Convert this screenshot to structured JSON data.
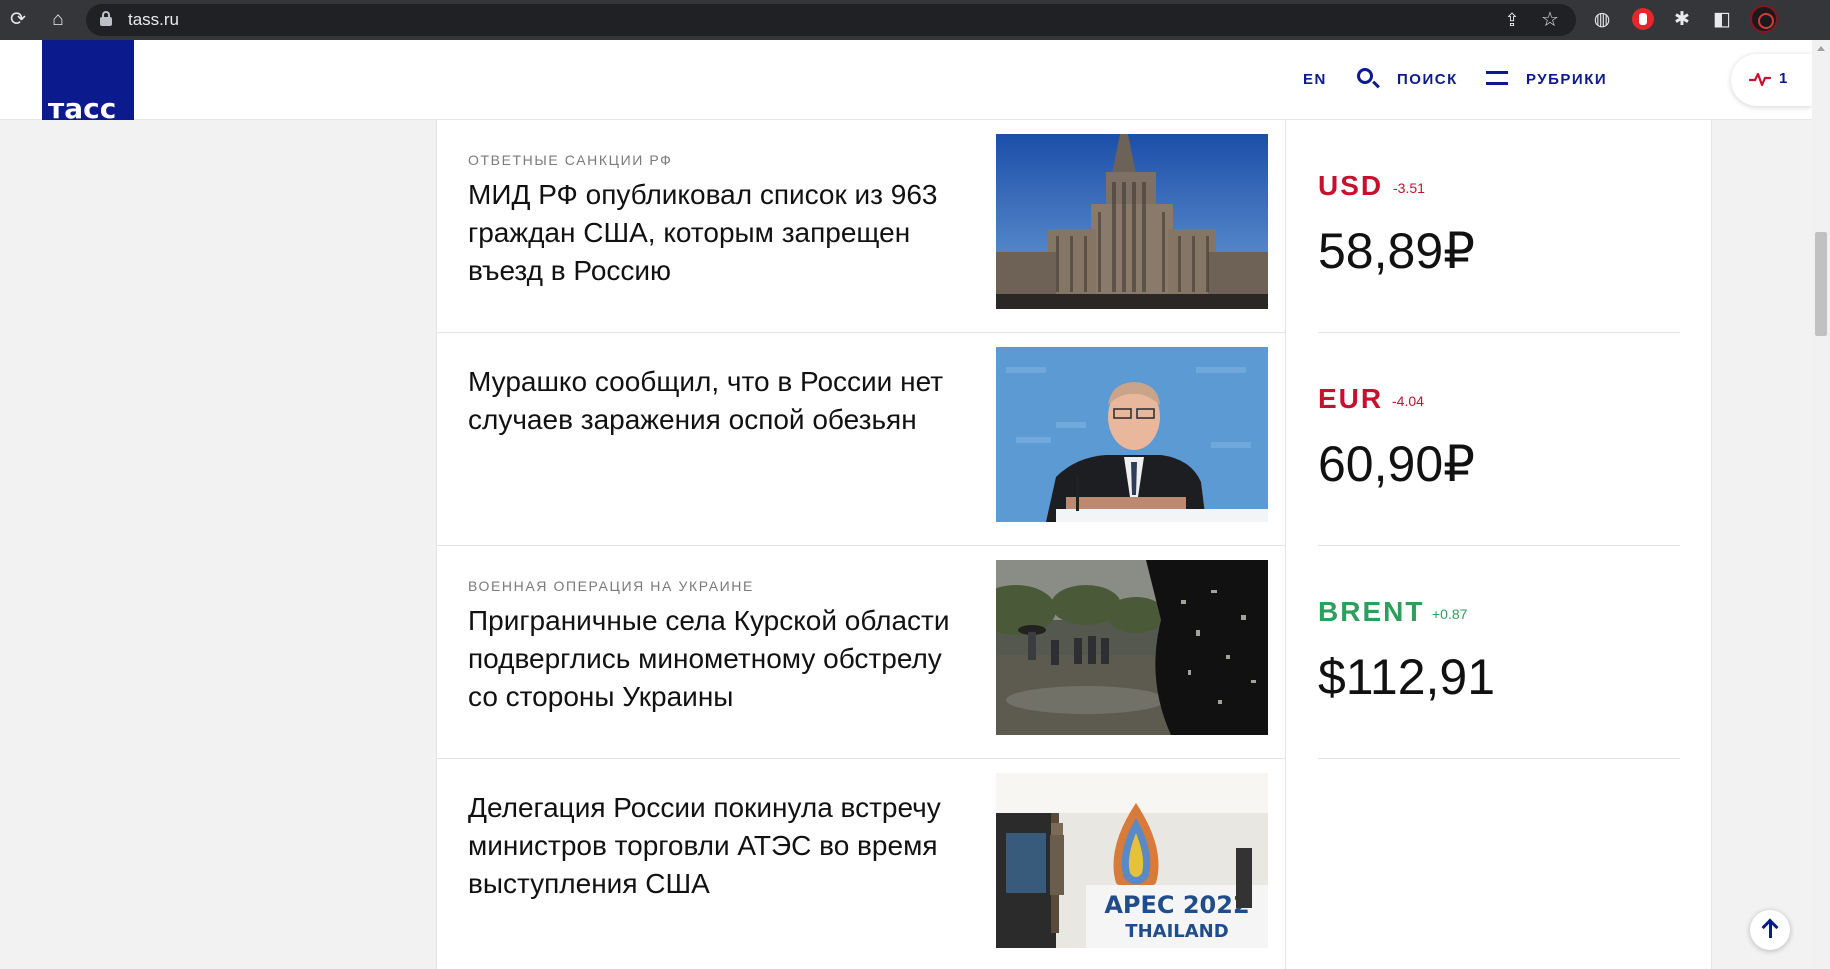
{
  "browser": {
    "url": "tass.ru"
  },
  "header": {
    "logo_text": "тасс",
    "lang_label": "EN",
    "search_label": "ПОИСК",
    "rubrics_label": "РУБРИКИ",
    "live_count": "1"
  },
  "news": [
    {
      "rubric": "Ответные санкции РФ",
      "title": "МИД РФ опубликовал список из 963 граждан США, которым запрещен въезд в Россию",
      "image": "mfa-building-photo"
    },
    {
      "rubric": "",
      "title": "Мурашко сообщил, что в России нет случаев заражения оспой обезьян",
      "image": "murashko-press-photo"
    },
    {
      "rubric": "Военная операция на Украине",
      "title": "Приграничные села Курской области подверглись минометному обстрелу со стороны Украины",
      "image": "shelled-village-photo"
    },
    {
      "rubric": "",
      "title": "Делегация России покинула встречу министров торговли АТЭС во время выступления США",
      "image": "apec-2022-photo"
    }
  ],
  "rates": [
    {
      "code": "USD",
      "change": "-3.51",
      "value": "58,89₽",
      "color": "#c8102e"
    },
    {
      "code": "EUR",
      "change": "-4.04",
      "value": "60,90₽",
      "color": "#c8102e"
    },
    {
      "code": "BRENT",
      "change": "+0.87",
      "value": "$112,91",
      "color": "#2e9e5b"
    }
  ],
  "apec_image_text": {
    "line1": "APEC 2022",
    "line2": "THAILAND"
  }
}
